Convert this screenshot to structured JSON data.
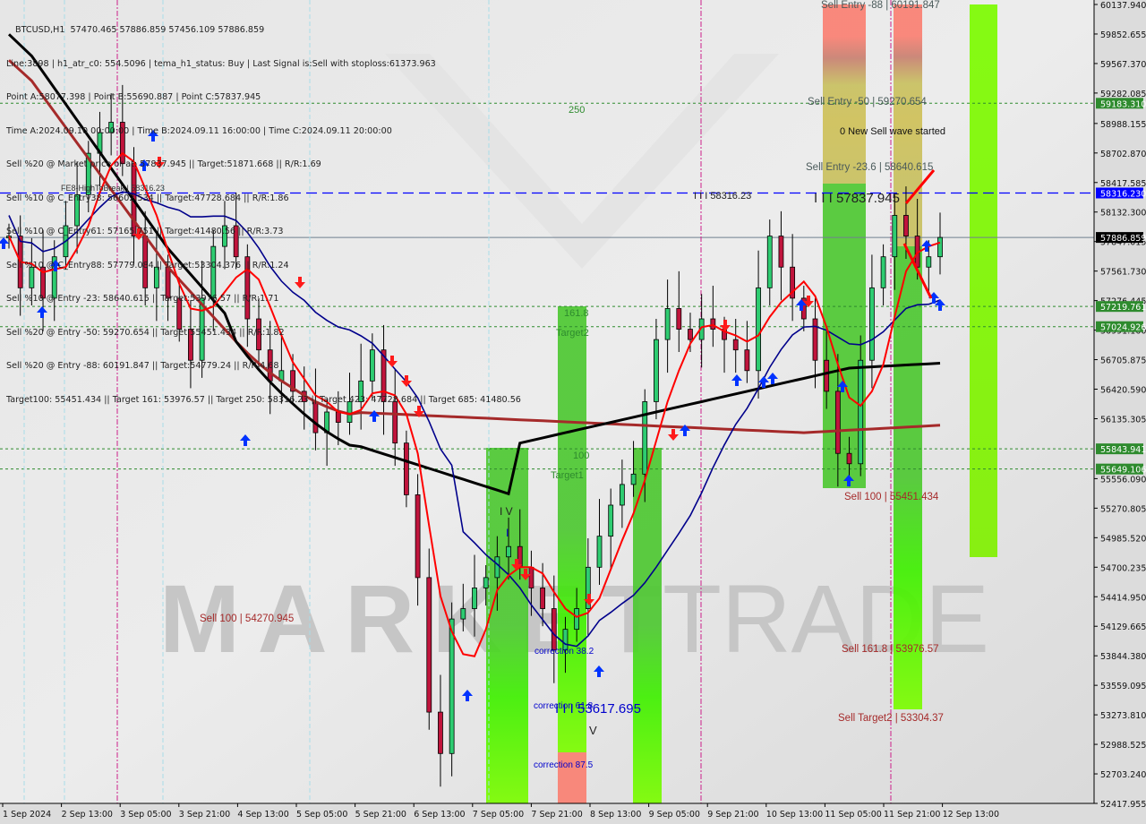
{
  "window": {
    "symbol_line": "BTCUSD,H1  57470.465 57886.859 57456.109 57886.859"
  },
  "info_lines": [
    "Line:3898 | h1_atr_c0: 554.5096 | tema_h1_status: Buy | Last Signal is:Sell with stoploss:61373.963",
    "Point A:58077.398 | Point B:55690.887 | Point C:57837.945",
    "Time A:2024.09.10 00:00:00 | Time B:2024.09.11 16:00:00 | Time C:2024.09.11 20:00:00",
    "Sell %20 @ Market price or at: 57837.945 || Target:51871.668 || R/R:1.69",
    "Sell %10 @ C_Entry38: 56602.534 || Target:47728.684 || R/R:1.86",
    "Sell %10 @ C_Entry61: 57165.751 || Target:41480.56 || R/R:3.73",
    "Sell %10 @ C_Entry88: 57779.084 || Target:53304.376 || R/R:1.24",
    "Sell %10 @ Entry -23: 58640.615 || Target:53976.57 || R/R:1.71",
    "Sell %20 @ Entry -50: 59270.654 || Target:55451.434 || R/R:1.82",
    "Sell %20 @ Entry -88: 60191.847 || Target:54779.24 || R/R:4.68",
    "Target100: 55451.434 || Target 161: 53976.57 || Target 250: 58316.23 || Target 423: 47728.684 || Target 685: 41480.56"
  ],
  "chart_data": {
    "type": "candlestick",
    "title": "BTCUSD,H1",
    "ohlc_last": {
      "open": 57470.465,
      "high": 57886.859,
      "low": 57456.109,
      "close": 57886.859
    },
    "ylim": [
      52417.955,
      60137.94
    ],
    "y_ticks": [
      "60137.940",
      "59852.655",
      "59567.370",
      "59282.085",
      "58988.155",
      "58702.870",
      "58417.585",
      "58132.300",
      "57847.015",
      "57561.730",
      "57276.445",
      "56991.160",
      "56705.875",
      "56420.590",
      "56135.305",
      "55556.090",
      "55270.805",
      "54985.520",
      "54700.235",
      "54414.950",
      "54129.665",
      "53844.380",
      "53559.095",
      "53273.810",
      "52988.525",
      "52703.240",
      "52417.955"
    ],
    "x_ticks": [
      "1 Sep 2024",
      "2 Sep 13:00",
      "3 Sep 05:00",
      "3 Sep 21:00",
      "4 Sep 13:00",
      "5 Sep 05:00",
      "5 Sep 21:00",
      "6 Sep 13:00",
      "7 Sep 05:00",
      "7 Sep 21:00",
      "8 Sep 13:00",
      "9 Sep 05:00",
      "9 Sep 21:00",
      "10 Sep 13:00",
      "11 Sep 05:00",
      "11 Sep 21:00",
      "12 Sep 13:00"
    ],
    "price_labels": [
      {
        "value": "59183.310",
        "kind": "level",
        "color": "#2e8b2e"
      },
      {
        "value": "58316.230",
        "kind": "high-to-break",
        "color": "#0000ff"
      },
      {
        "value": "57886.859",
        "kind": "current",
        "color": "#000000"
      },
      {
        "value": "57219.761",
        "kind": "level",
        "color": "#2e8b2e"
      },
      {
        "value": "57024.926",
        "kind": "level",
        "color": "#2e8b2e"
      },
      {
        "value": "55843.941",
        "kind": "level",
        "color": "#2e8b2e"
      },
      {
        "value": "55649.106",
        "kind": "level",
        "color": "#2e8b2e"
      }
    ],
    "annotations": [
      {
        "text": "Sell Entry -88 | 60191.847",
        "price": 60191.847,
        "color": "#4a5a5a"
      },
      {
        "text": "Sell Entry -50 | 59270.654",
        "price": 59270.654,
        "color": "#4a5a5a"
      },
      {
        "text": "0 New Sell wave started",
        "price": 59000,
        "color": "#111111"
      },
      {
        "text": "Sell Entry -23.6 | 58640.615",
        "price": 58640.615,
        "color": "#4a5a5a"
      },
      {
        "text": "I I I 57837.945",
        "price": 57837.945,
        "color": "#222222"
      },
      {
        "text": "Sell 100 | 55451.434",
        "price": 55451.434,
        "color": "#a52a2a"
      },
      {
        "text": "Sell 161.8 | 53976.57",
        "price": 53976.57,
        "color": "#a52a2a"
      },
      {
        "text": "Sell Target2 | 53304.37",
        "price": 53304.37,
        "color": "#a52a2a"
      },
      {
        "text": "Sell 100 | 54270.945",
        "price": 54270.945,
        "color": "#a52a2a"
      },
      {
        "text": "FE8-HighToBreak | 58316.23",
        "price": 58316.23,
        "color": "#333333"
      },
      {
        "text": "I I I 58316.23",
        "price": 58316.23,
        "color": "#222222"
      },
      {
        "text": "250",
        "price": 59183.31,
        "color": "#2e8b2e"
      },
      {
        "text": "161.8",
        "price": 57219.761,
        "color": "#2e8b2e"
      },
      {
        "text": "Target2",
        "price": 57024.926,
        "color": "#2e8b2e"
      },
      {
        "text": "100",
        "price": 55843.941,
        "color": "#2e8b2e"
      },
      {
        "text": "Target1",
        "price": 55649.106,
        "color": "#2e8b2e"
      },
      {
        "text": "correction 38.2",
        "price": 53900,
        "color": "#0000cc"
      },
      {
        "text": "correction 61.8",
        "price": 53300,
        "color": "#0000cc"
      },
      {
        "text": "I I I 53617.695",
        "price": 53617.695,
        "color": "#0000cc"
      },
      {
        "text": "correction 87.5",
        "price": 52750,
        "color": "#0000cc"
      },
      {
        "text": "I V",
        "price": 55200,
        "color": "#222222"
      },
      {
        "text": "I",
        "price": 55000,
        "color": "#0000cc"
      },
      {
        "text": "V",
        "price": 53050,
        "color": "#222222"
      }
    ],
    "watermark": "MARKETTRADE",
    "series": [
      {
        "name": "close-approx",
        "color": "#000000",
        "values": [
          57900,
          57400,
          57600,
          57300,
          57700,
          58000,
          58300,
          58700,
          58900,
          59000,
          58600,
          57900,
          57400,
          57600,
          57300,
          57000,
          56700,
          57300,
          57800,
          58000,
          57700,
          57100,
          56800,
          56500,
          56600,
          56400,
          56300,
          56000,
          56200,
          56100,
          56300,
          56500,
          56800,
          56300,
          55900,
          55400,
          54600,
          53300,
          52900,
          54200,
          54300,
          54500,
          54600,
          54800,
          54900,
          54700,
          54500,
          54300,
          53900,
          54100,
          54300,
          54700,
          55000,
          55300,
          55500,
          55600,
          56300,
          56900,
          57200,
          57000,
          56900,
          57100,
          57000,
          56900,
          56800,
          56600,
          57400,
          57900,
          57600,
          57300,
          57100,
          56700,
          56400,
          55800,
          55700,
          56700,
          57400,
          57700,
          58100,
          57900,
          57600,
          57700,
          57886.859
        ]
      },
      {
        "name": "ema-fast-red",
        "color": "#ff0000"
      },
      {
        "name": "ema-navy",
        "color": "#00008b"
      },
      {
        "name": "ma-black",
        "color": "#000000"
      },
      {
        "name": "ma-brown",
        "color": "#a52a2a"
      }
    ]
  }
}
